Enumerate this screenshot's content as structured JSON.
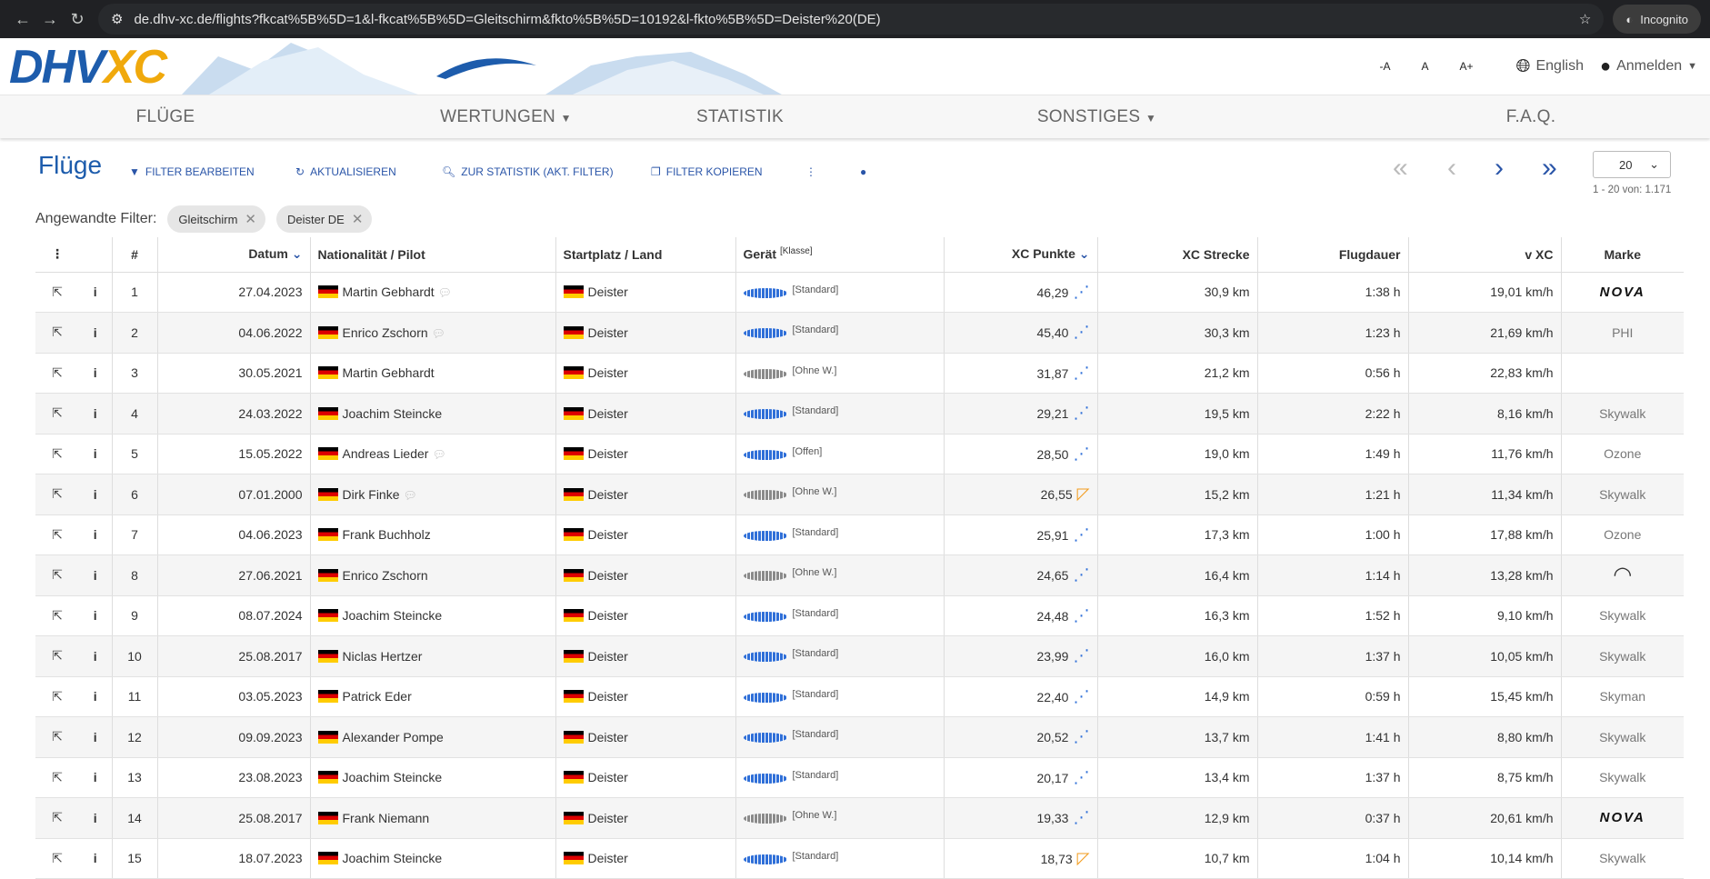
{
  "browser": {
    "url": "de.dhv-xc.de/flights?fkcat%5B%5D=1&l-fkcat%5B%5D=Gleitschirm&fkto%5B%5D=10192&l-fkto%5B%5D=Deister%20(DE)",
    "incognito_label": "Incognito"
  },
  "header": {
    "logo_main": "DHV",
    "logo_accent": "XC",
    "font_dec": "-A",
    "font_norm": "A",
    "font_inc": "A+",
    "language": "English",
    "login": "Anmelden"
  },
  "nav": {
    "items": [
      "FLÜGE",
      "WERTUNGEN",
      "STATISTIK",
      "SONSTIGES",
      "F.A.Q."
    ]
  },
  "toolbar": {
    "title": "Flüge",
    "edit_filter": "FILTER BEARBEITEN",
    "refresh": "AKTUALISIEREN",
    "to_stats": "ZUR STATISTIK (AKT. FILTER)",
    "copy_filter": "FILTER KOPIEREN",
    "page_size": "20",
    "page_info": "1 - 20 von: 1.171"
  },
  "filters": {
    "label": "Angewandte Filter:",
    "chips": [
      "Gleitschirm",
      "Deister DE"
    ]
  },
  "table": {
    "headers": {
      "num": "#",
      "date": "Datum",
      "pilot": "Nationalität / Pilot",
      "start": "Startplatz / Land",
      "device": "Gerät",
      "device_sup": "[Klasse]",
      "points": "XC Punkte",
      "distance": "XC Strecke",
      "duration": "Flugdauer",
      "speed": "v XC",
      "brand": "Marke"
    },
    "rows": [
      {
        "n": "1",
        "date": "27.04.2023",
        "pilot": "Martin Gebhardt",
        "comment": true,
        "start": "Deister",
        "cls": "[Standard]",
        "gray": false,
        "pts": "46,29",
        "tri": false,
        "dist": "30,9 km",
        "dur": "1:38 h",
        "v": "19,01 km/h",
        "brand": "NOVA",
        "btype": "nova"
      },
      {
        "n": "2",
        "date": "04.06.2022",
        "pilot": "Enrico Zschorn",
        "comment": true,
        "start": "Deister",
        "cls": "[Standard]",
        "gray": false,
        "pts": "45,40",
        "tri": false,
        "dist": "30,3 km",
        "dur": "1:23 h",
        "v": "21,69 km/h",
        "brand": "PHI",
        "btype": "text"
      },
      {
        "n": "3",
        "date": "30.05.2021",
        "pilot": "Martin Gebhardt",
        "comment": false,
        "start": "Deister",
        "cls": "[Ohne W.]",
        "gray": true,
        "pts": "31,87",
        "tri": false,
        "dist": "21,2 km",
        "dur": "0:56 h",
        "v": "22,83 km/h",
        "brand": "",
        "btype": "text"
      },
      {
        "n": "4",
        "date": "24.03.2022",
        "pilot": "Joachim Steincke",
        "comment": false,
        "start": "Deister",
        "cls": "[Standard]",
        "gray": false,
        "pts": "29,21",
        "tri": false,
        "dist": "19,5 km",
        "dur": "2:22 h",
        "v": "8,16 km/h",
        "brand": "Skywalk",
        "btype": "text"
      },
      {
        "n": "5",
        "date": "15.05.2022",
        "pilot": "Andreas Lieder",
        "comment": true,
        "start": "Deister",
        "cls": "[Offen]",
        "gray": false,
        "pts": "28,50",
        "tri": false,
        "dist": "19,0 km",
        "dur": "1:49 h",
        "v": "11,76 km/h",
        "brand": "Ozone",
        "btype": "text"
      },
      {
        "n": "6",
        "date": "07.01.2000",
        "pilot": "Dirk Finke",
        "comment": true,
        "start": "Deister",
        "cls": "[Ohne W.]",
        "gray": true,
        "pts": "26,55",
        "tri": true,
        "dist": "15,2 km",
        "dur": "1:21 h",
        "v": "11,34 km/h",
        "brand": "Skywalk",
        "btype": "text"
      },
      {
        "n": "7",
        "date": "04.06.2023",
        "pilot": "Frank Buchholz",
        "comment": false,
        "start": "Deister",
        "cls": "[Standard]",
        "gray": false,
        "pts": "25,91",
        "tri": false,
        "dist": "17,3 km",
        "dur": "1:00 h",
        "v": "17,88 km/h",
        "brand": "Ozone",
        "btype": "text"
      },
      {
        "n": "8",
        "date": "27.06.2021",
        "pilot": "Enrico Zschorn",
        "comment": false,
        "start": "Deister",
        "cls": "[Ohne W.]",
        "gray": true,
        "pts": "24,65",
        "tri": false,
        "dist": "16,4 km",
        "dur": "1:14 h",
        "v": "13,28 km/h",
        "brand": "",
        "btype": "logo"
      },
      {
        "n": "9",
        "date": "08.07.2024",
        "pilot": "Joachim Steincke",
        "comment": false,
        "start": "Deister",
        "cls": "[Standard]",
        "gray": false,
        "pts": "24,48",
        "tri": false,
        "dist": "16,3 km",
        "dur": "1:52 h",
        "v": "9,10 km/h",
        "brand": "Skywalk",
        "btype": "text"
      },
      {
        "n": "10",
        "date": "25.08.2017",
        "pilot": "Niclas Hertzer",
        "comment": false,
        "start": "Deister",
        "cls": "[Standard]",
        "gray": false,
        "pts": "23,99",
        "tri": false,
        "dist": "16,0 km",
        "dur": "1:37 h",
        "v": "10,05 km/h",
        "brand": "Skywalk",
        "btype": "text"
      },
      {
        "n": "11",
        "date": "03.05.2023",
        "pilot": "Patrick Eder",
        "comment": false,
        "start": "Deister",
        "cls": "[Standard]",
        "gray": false,
        "pts": "22,40",
        "tri": false,
        "dist": "14,9 km",
        "dur": "0:59 h",
        "v": "15,45 km/h",
        "brand": "Skyman",
        "btype": "text"
      },
      {
        "n": "12",
        "date": "09.09.2023",
        "pilot": "Alexander Pompe",
        "comment": false,
        "start": "Deister",
        "cls": "[Standard]",
        "gray": false,
        "pts": "20,52",
        "tri": false,
        "dist": "13,7 km",
        "dur": "1:41 h",
        "v": "8,80 km/h",
        "brand": "Skywalk",
        "btype": "text"
      },
      {
        "n": "13",
        "date": "23.08.2023",
        "pilot": "Joachim Steincke",
        "comment": false,
        "start": "Deister",
        "cls": "[Standard]",
        "gray": false,
        "pts": "20,17",
        "tri": false,
        "dist": "13,4 km",
        "dur": "1:37 h",
        "v": "8,75 km/h",
        "brand": "Skywalk",
        "btype": "text"
      },
      {
        "n": "14",
        "date": "25.08.2017",
        "pilot": "Frank Niemann",
        "comment": false,
        "start": "Deister",
        "cls": "[Ohne W.]",
        "gray": true,
        "pts": "19,33",
        "tri": false,
        "dist": "12,9 km",
        "dur": "0:37 h",
        "v": "20,61 km/h",
        "brand": "NOVA",
        "btype": "nova"
      },
      {
        "n": "15",
        "date": "18.07.2023",
        "pilot": "Joachim Steincke",
        "comment": false,
        "start": "Deister",
        "cls": "[Standard]",
        "gray": false,
        "pts": "18,73",
        "tri": true,
        "dist": "10,7 km",
        "dur": "1:04 h",
        "v": "10,14 km/h",
        "brand": "Skywalk",
        "btype": "text"
      }
    ]
  }
}
